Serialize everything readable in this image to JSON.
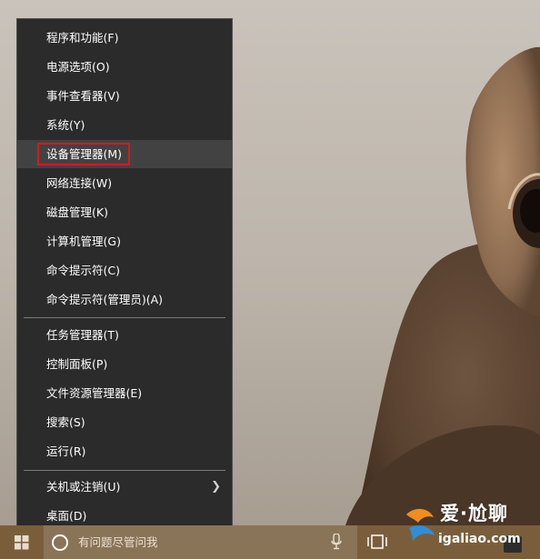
{
  "context_menu": {
    "items": [
      {
        "label": "程序和功能(F)"
      },
      {
        "label": "电源选项(O)"
      },
      {
        "label": "事件查看器(V)"
      },
      {
        "label": "系统(Y)"
      },
      {
        "label": "设备管理器(M)"
      },
      {
        "label": "网络连接(W)"
      },
      {
        "label": "磁盘管理(K)"
      },
      {
        "label": "计算机管理(G)"
      },
      {
        "label": "命令提示符(C)"
      },
      {
        "label": "命令提示符(管理员)(A)"
      },
      {
        "label": "任务管理器(T)"
      },
      {
        "label": "控制面板(P)"
      },
      {
        "label": "文件资源管理器(E)"
      },
      {
        "label": "搜索(S)"
      },
      {
        "label": "运行(R)"
      },
      {
        "label": "关机或注销(U)"
      },
      {
        "label": "桌面(D)"
      }
    ],
    "highlighted_label": "设备管理器(M)",
    "highlight_color": "#d71920"
  },
  "taskbar": {
    "search_placeholder": "有问题尽管问我",
    "icons": [
      "windows-start-icon",
      "cortana-icon",
      "microphone-icon",
      "task-view-icon",
      "store-icon"
    ],
    "color": "#7a5e3c"
  },
  "watermark": {
    "title": "爱·尬聊",
    "subtitle": "igaliao.com"
  }
}
